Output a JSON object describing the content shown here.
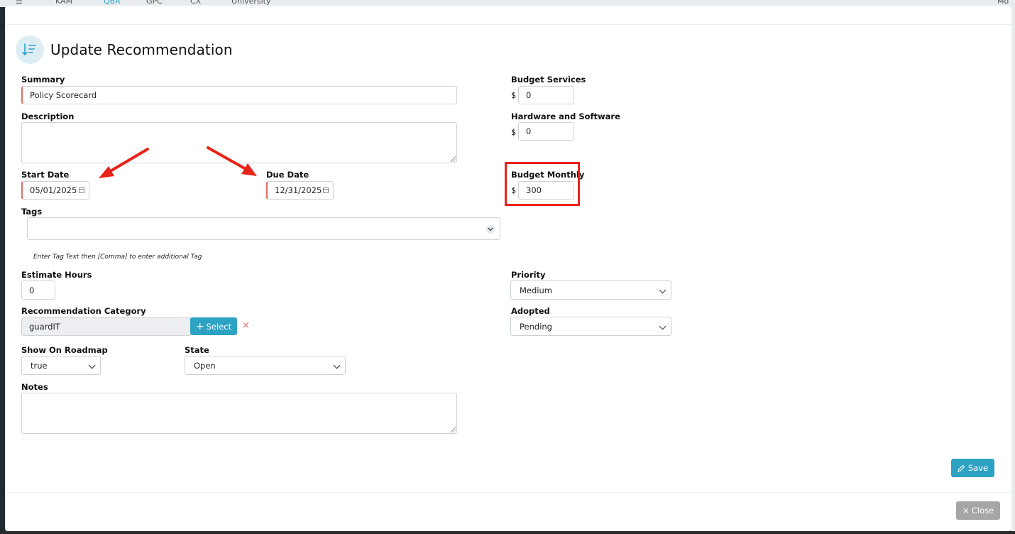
{
  "background": {
    "nav_items": [
      "KAM",
      "QBR",
      "GPC",
      "CX",
      "University"
    ],
    "right_label": "Mo"
  },
  "modal": {
    "title": "Update Recommendation"
  },
  "form": {
    "summary": {
      "label": "Summary",
      "value": "Policy Scorecard"
    },
    "description": {
      "label": "Description",
      "value": ""
    },
    "start_date": {
      "label": "Start Date",
      "value": "05/01/2025"
    },
    "due_date": {
      "label": "Due Date",
      "value": "12/31/2025"
    },
    "tags": {
      "label": "Tags",
      "value": "",
      "hint": "Enter Tag Text then [Comma] to enter additional Tag"
    },
    "estimate_hours": {
      "label": "Estimate Hours",
      "value": "0"
    },
    "recommendation_category": {
      "label": "Recommendation Category",
      "value": "guardIT",
      "select_label": "Select"
    },
    "show_on_roadmap": {
      "label": "Show On Roadmap",
      "value": "true"
    },
    "state": {
      "label": "State",
      "value": "Open"
    },
    "notes": {
      "label": "Notes",
      "value": ""
    },
    "budget_services": {
      "label": "Budget Services",
      "currency": "$",
      "value": "0"
    },
    "hardware_software": {
      "label": "Hardware and Software",
      "currency": "$",
      "value": "0"
    },
    "budget_monthly": {
      "label": "Budget Monthly",
      "currency": "$",
      "value": "300"
    },
    "priority": {
      "label": "Priority",
      "value": "Medium"
    },
    "adopted": {
      "label": "Adopted",
      "value": "Pending"
    }
  },
  "buttons": {
    "save": "Save",
    "close": "Close"
  },
  "annotation_color": "#e8241a",
  "accent_color": "#2ea2c3"
}
